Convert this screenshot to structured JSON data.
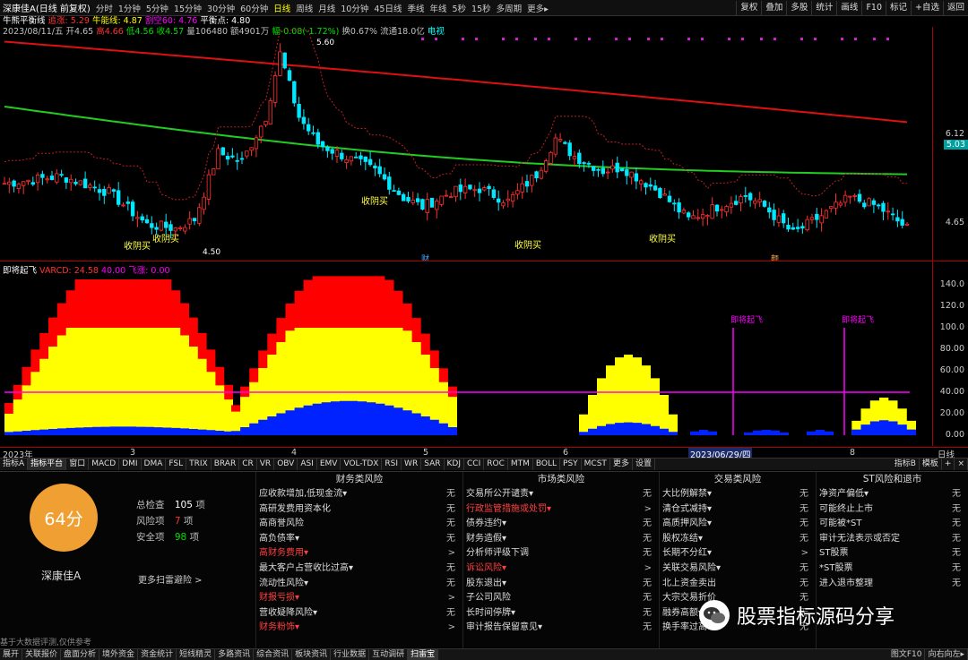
{
  "topbar": {
    "title": "深康佳A(日线 前复权)",
    "periods": [
      "分时",
      "1分钟",
      "5分钟",
      "15分钟",
      "30分钟",
      "60分钟",
      "日线",
      "周线",
      "月线",
      "10分钟",
      "45日线",
      "季线",
      "年线",
      "5秒",
      "15秒",
      "多周期",
      "更多▸"
    ],
    "active_period": "日线",
    "right_buttons": [
      "复权",
      "叠加",
      "多股",
      "统计",
      "画线",
      "F10",
      "标记",
      "+自选",
      "返回"
    ]
  },
  "ohlc": {
    "date": "2023/08/11/五",
    "open": "开4.65",
    "high": "高4.66",
    "low": "低4.56",
    "close": "收4.57",
    "volume": "量106480",
    "amount": "额4901万",
    "change": "幅-0.08(-1.72%)",
    "turnover": "换0.67%",
    "float_cap": "流通18.0亿",
    "tag": "电视",
    "ma_label": "牛熊平衡线",
    "ma_values": [
      "追涨: 5.29",
      "牛能线: 4.87",
      "割空60: 4.76",
      "平衡点: 4.80"
    ]
  },
  "kline": {
    "peak_label": "5.60",
    "low_label": "4.50",
    "signals": [
      "收阴买",
      "收阴买",
      "收阴买",
      "收阴买",
      "收阴买"
    ],
    "markers": [
      "财",
      "颜"
    ],
    "price_ticks": [
      "6.12",
      "4.65"
    ],
    "current_price": "5.03"
  },
  "indicator": {
    "name": "即将起飞",
    "var_label": "VARCD: 24.58",
    "v2": "40.00",
    "v3": "飞涨: 0.00",
    "ticks": [
      "140.0",
      "120.0",
      "100.0",
      "80.00",
      "60.00",
      "40.00",
      "20.00",
      "0.00"
    ],
    "flag_labels": [
      "即将起飞",
      "即将起飞"
    ]
  },
  "xaxis": {
    "labels": [
      "2023年",
      "3",
      "4",
      "5",
      "6",
      "2023/06/29/四",
      "8"
    ],
    "right_label": "日线"
  },
  "tabbar": {
    "tabs": [
      "指标A",
      "指标平台",
      "窗口",
      "MACD",
      "DMI",
      "DMA",
      "FSL",
      "TRIX",
      "BRAR",
      "CR",
      "VR",
      "OBV",
      "ASI",
      "EMV",
      "VOL-TDX",
      "RSI",
      "WR",
      "SAR",
      "KDJ",
      "CCI",
      "ROC",
      "MTM",
      "BOLL",
      "PSY",
      "MCST",
      "更多",
      "设置"
    ],
    "active": "指标平台",
    "right": [
      "指标B",
      "模板",
      "+",
      "×"
    ]
  },
  "risk": {
    "score": "64分",
    "stock_name": "深康佳A",
    "total_label": "总检查",
    "total_value": "105",
    "total_unit": "项",
    "risk_label": "风险项",
    "risk_value": "7",
    "risk_unit": "项",
    "safe_label": "安全项",
    "safe_value": "98",
    "safe_unit": "项",
    "more_scan": "更多扫雷避险 >",
    "columns": [
      {
        "title": "财务类风险",
        "items": [
          {
            "text": "应收款增加,低现金流▾",
            "value": "无",
            "red": false
          },
          {
            "text": "高研发费用资本化",
            "value": "无",
            "red": false
          },
          {
            "text": "高商誉风险",
            "value": "无",
            "red": false
          },
          {
            "text": "高负债率▾",
            "value": "无",
            "red": false
          },
          {
            "text": "高财务费用▾",
            "value": ">",
            "red": true
          },
          {
            "text": "最大客户占营收比过高▾",
            "value": "无",
            "red": false
          },
          {
            "text": "流动性风险▾",
            "value": "无",
            "red": false
          },
          {
            "text": "财报亏损▾",
            "value": ">",
            "red": true
          },
          {
            "text": "营收疑降风险▾",
            "value": "无",
            "red": false
          },
          {
            "text": "财务粉饰▾",
            "value": ">",
            "red": true
          }
        ]
      },
      {
        "title": "市场类风险",
        "items": [
          {
            "text": "交易所公开谴责▾",
            "value": "无",
            "red": false
          },
          {
            "text": "行政监管措施或处罚▾",
            "value": ">",
            "red": true
          },
          {
            "text": "债券违约▾",
            "value": "无",
            "red": false
          },
          {
            "text": "财务造假▾",
            "value": "无",
            "red": false
          },
          {
            "text": "分析师评级下调",
            "value": "无",
            "red": false
          },
          {
            "text": "诉讼风险▾",
            "value": ">",
            "red": true
          },
          {
            "text": "股东退出▾",
            "value": "无",
            "red": false
          },
          {
            "text": "子公司风险",
            "value": "无",
            "red": false
          },
          {
            "text": "长时间停牌▾",
            "value": "无",
            "red": false
          },
          {
            "text": "审计报告保留意见▾",
            "value": "无",
            "red": false
          }
        ]
      },
      {
        "title": "交易类风险",
        "items": [
          {
            "text": "大比例解禁▾",
            "value": "无",
            "red": false
          },
          {
            "text": "清仓式减持▾",
            "value": "无",
            "red": false
          },
          {
            "text": "高质押风险▾",
            "value": "无",
            "red": false
          },
          {
            "text": "股权冻结▾",
            "value": "无",
            "red": false
          },
          {
            "text": "长期不分红▾",
            "value": ">",
            "red": false
          },
          {
            "text": "关联交易风险▾",
            "value": "无",
            "red": false
          },
          {
            "text": "北上资金卖出",
            "value": "无",
            "red": false
          },
          {
            "text": "大宗交易折价",
            "value": "无",
            "red": false
          },
          {
            "text": "融券高额▾",
            "value": "无",
            "red": false
          },
          {
            "text": "换手率过高▾",
            "value": "无",
            "red": false
          }
        ]
      },
      {
        "title": "ST风险和退市",
        "items": [
          {
            "text": "净资产偏低▾",
            "value": "无",
            "red": false
          },
          {
            "text": "可能终止上市",
            "value": "无",
            "red": false
          },
          {
            "text": "可能被*ST",
            "value": "无",
            "red": false
          },
          {
            "text": "审计无法表示或否定",
            "value": "无",
            "red": false
          },
          {
            "text": "ST股票",
            "value": "无",
            "red": false
          },
          {
            "text": "*ST股票",
            "value": "无",
            "red": false
          },
          {
            "text": "进入退市整理",
            "value": "无",
            "red": false
          }
        ]
      }
    ]
  },
  "disclaimer": "基于大数据评测,仅供参考",
  "botbar": {
    "tabs": [
      "展开",
      "关联报价",
      "盘面分析",
      "境外资金",
      "资金统计",
      "短线精灵",
      "多路资讯",
      "综合资讯",
      "板块资讯",
      "行业数据",
      "互动调研",
      "扫雷宝"
    ],
    "active": "扫雷宝",
    "right": [
      "图文F10",
      "向右向左▸"
    ]
  },
  "watermark": "股票指标源码分享",
  "colors": {
    "up": "#ff3030",
    "down": "#00e8ff",
    "ma_red": "#dd1111",
    "ma_green": "#22cc22",
    "area_yellow": "#ffff00",
    "area_red": "#ff0000",
    "area_blue": "#0022ff",
    "flag": "#ff00ff",
    "score_bg": "#f0a032"
  }
}
